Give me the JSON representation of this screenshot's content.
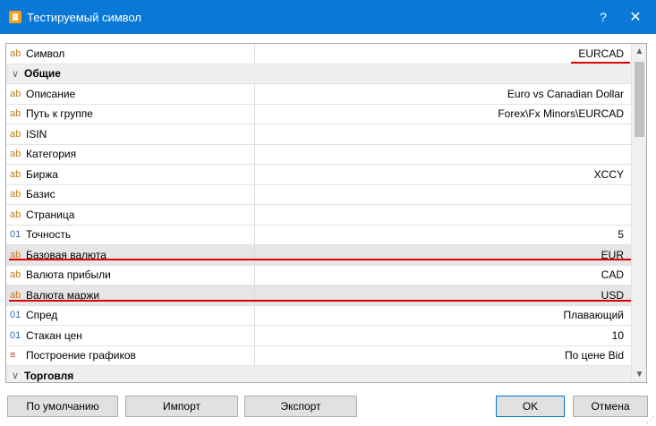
{
  "window": {
    "title": "Тестируемый символ",
    "help_label": "?",
    "close_label": "✕"
  },
  "icons": {
    "string": "ab",
    "number": "01",
    "chart": "≡",
    "chevron": "∨"
  },
  "rows": [
    {
      "type": "prop",
      "icon": "string",
      "label": "Символ",
      "value": "EURCAD"
    },
    {
      "type": "cat",
      "label": "Общие"
    },
    {
      "type": "prop",
      "icon": "string",
      "label": "Описание",
      "value": "Euro vs Canadian Dollar"
    },
    {
      "type": "prop",
      "icon": "string",
      "label": "Путь к группе",
      "value": "Forex\\Fx Minors\\EURCAD"
    },
    {
      "type": "prop",
      "icon": "string",
      "label": "ISIN",
      "value": ""
    },
    {
      "type": "prop",
      "icon": "string",
      "label": "Категория",
      "value": ""
    },
    {
      "type": "prop",
      "icon": "string",
      "label": "Биржа",
      "value": "XCCY"
    },
    {
      "type": "prop",
      "icon": "string",
      "label": "Базис",
      "value": ""
    },
    {
      "type": "prop",
      "icon": "string",
      "label": "Страница",
      "value": ""
    },
    {
      "type": "prop",
      "icon": "number",
      "label": "Точность",
      "value": "5"
    },
    {
      "type": "prop",
      "icon": "string",
      "label": "Базовая валюта",
      "value": "EUR"
    },
    {
      "type": "prop",
      "icon": "string",
      "label": "Валюта прибыли",
      "value": "CAD"
    },
    {
      "type": "prop",
      "icon": "string",
      "label": "Валюта маржи",
      "value": "USD"
    },
    {
      "type": "prop",
      "icon": "number",
      "label": "Спред",
      "value": "Плавающий"
    },
    {
      "type": "prop",
      "icon": "number",
      "label": "Стакан цен",
      "value": "10"
    },
    {
      "type": "prop",
      "icon": "chart",
      "label": "Построение графиков",
      "value": "По цене Bid"
    },
    {
      "type": "cat",
      "label": "Торговля"
    }
  ],
  "buttons": {
    "defaults": "По умолчанию",
    "import": "Импорт",
    "export": "Экспорт",
    "ok": "OK",
    "cancel": "Отмена"
  },
  "colors": {
    "titlebar": "#0a78d7",
    "highlight_line": "#e00000",
    "string_icon": "#c47a18",
    "number_icon": "#2f6db5"
  }
}
